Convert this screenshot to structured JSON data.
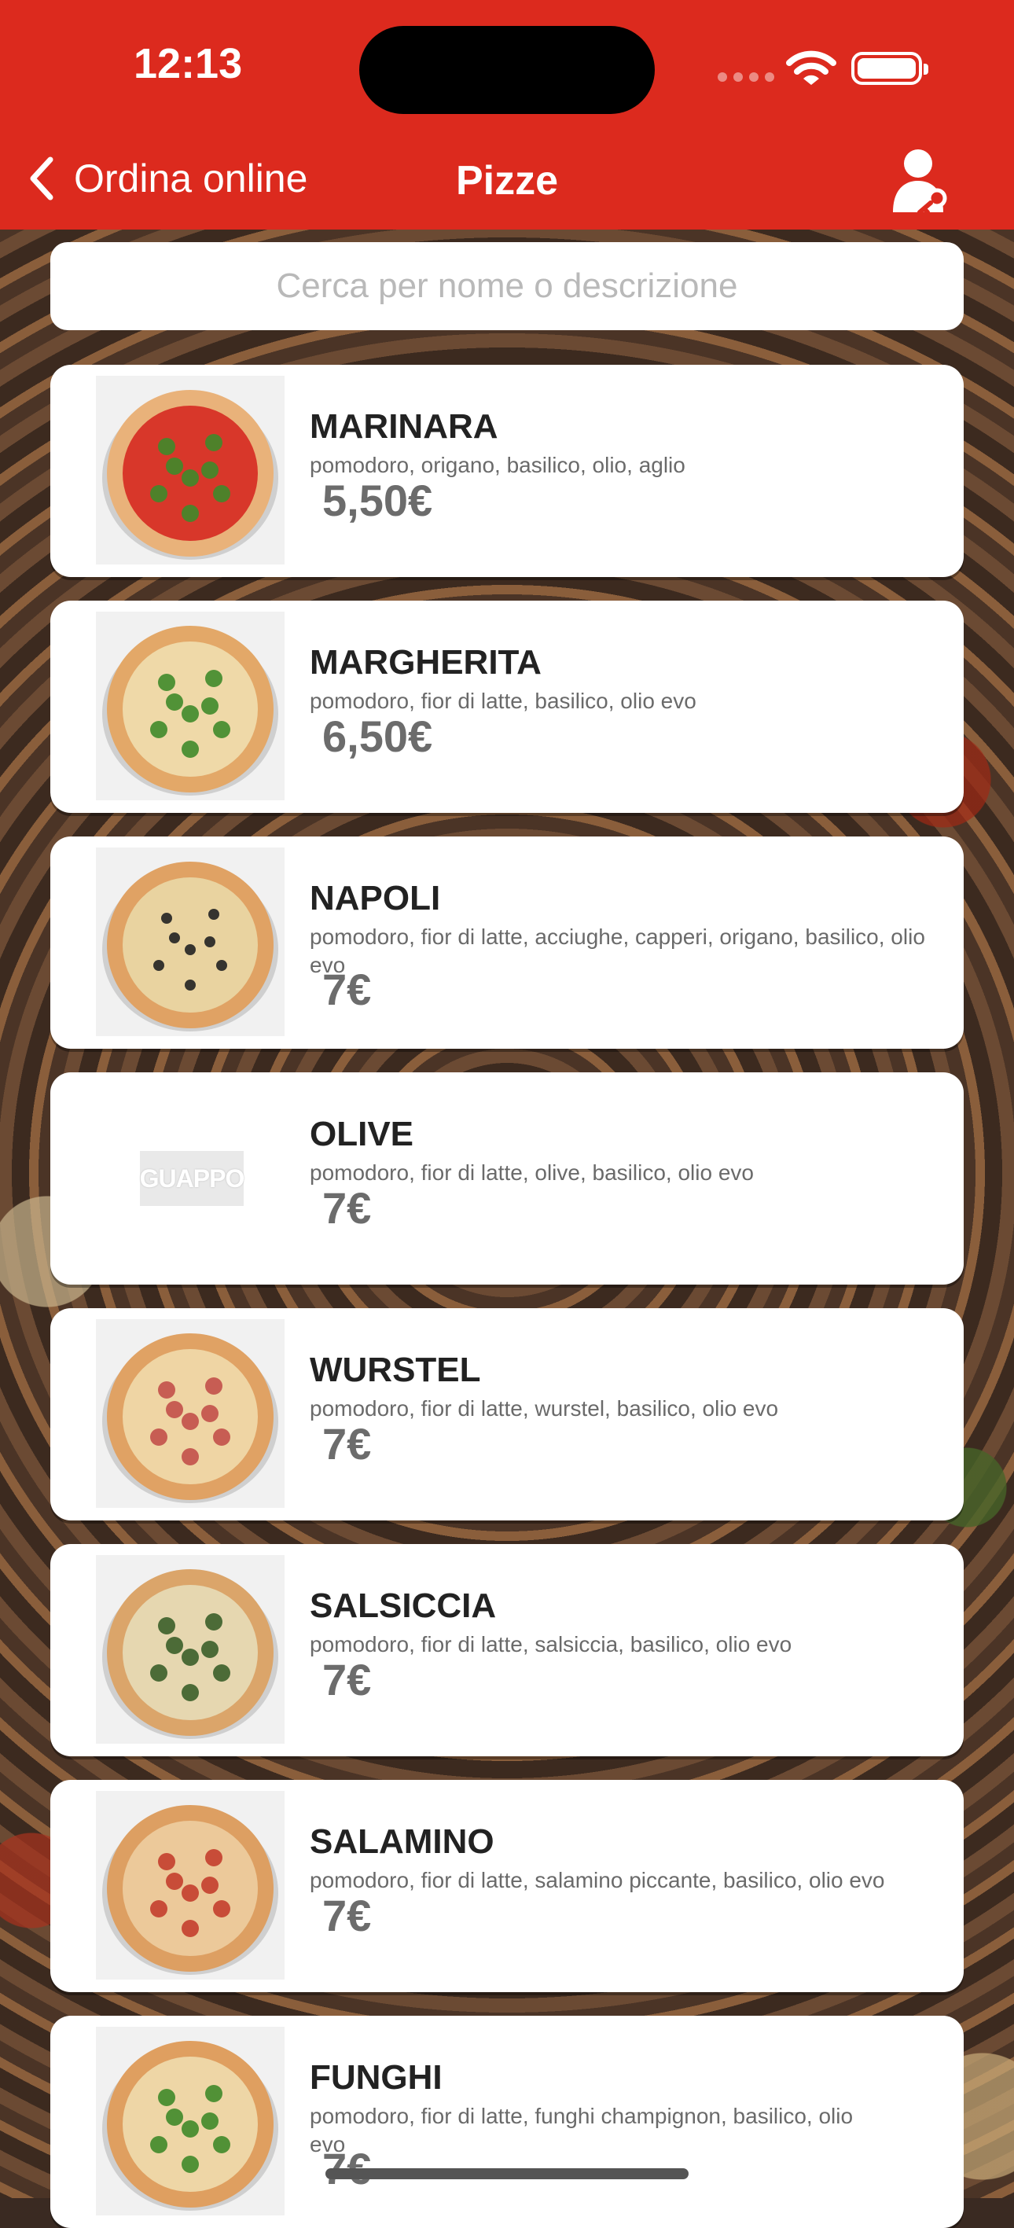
{
  "status": {
    "time": "12:13"
  },
  "nav": {
    "back_label": "Ordina online",
    "title": "Pizze"
  },
  "search": {
    "placeholder": "Cerca per nome o descrizione"
  },
  "menu": [
    {
      "name": "MARINARA",
      "description": "pomodoro, origano, basilico, olio, aglio",
      "price": "5,50€",
      "image": "pizza-photo"
    },
    {
      "name": "MARGHERITA",
      "description": "pomodoro, fior di latte, basilico, olio evo",
      "price": "6,50€",
      "image": "pizza-photo"
    },
    {
      "name": "NAPOLI",
      "description": "pomodoro, fior di latte, acciughe, capperi, origano, basilico, olio evo",
      "price": "7€",
      "image": "pizza-photo"
    },
    {
      "name": "OLIVE",
      "description": "pomodoro, fior di latte, olive, basilico, olio evo",
      "price": "7€",
      "image": "placeholder-logo",
      "logo_text": "GUAPPO"
    },
    {
      "name": "WURSTEL",
      "description": "pomodoro, fior di latte, wurstel, basilico, olio evo",
      "price": "7€",
      "image": "pizza-photo"
    },
    {
      "name": "SALSICCIA",
      "description": "pomodoro, fior di latte, salsiccia, basilico, olio evo",
      "price": "7€",
      "image": "pizza-photo"
    },
    {
      "name": "SALAMINO",
      "description": "pomodoro, fior di latte, salamino piccante, basilico, olio evo",
      "price": "7€",
      "image": "pizza-photo"
    },
    {
      "name": "FUNGHI",
      "description": "pomodoro, fior di latte, funghi champignon, basilico, olio evo",
      "price": "7€",
      "image": "pizza-photo"
    }
  ],
  "colors": {
    "accent": "#dc2a1e"
  }
}
